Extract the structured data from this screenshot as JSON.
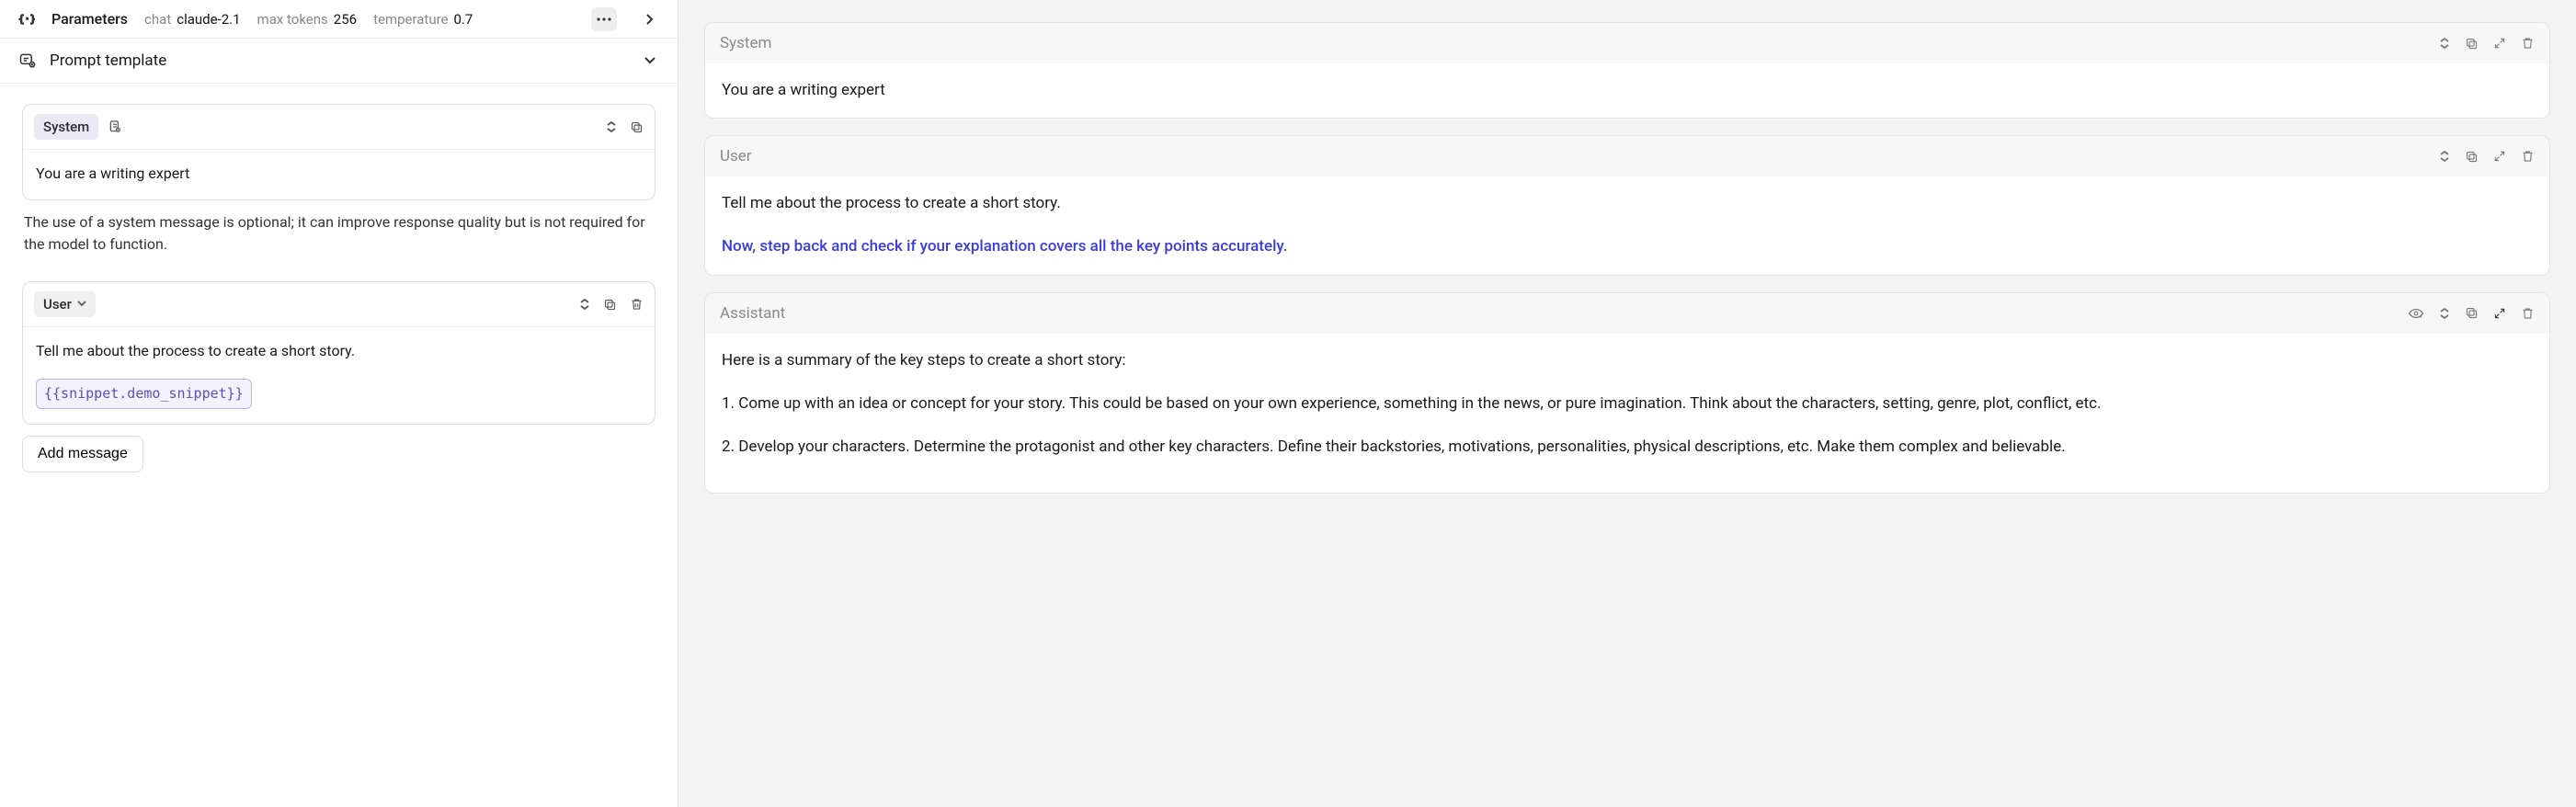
{
  "params": {
    "title": "Parameters",
    "chat_label": "chat",
    "chat_value": "claude-2.1",
    "max_tokens_label": "max tokens",
    "max_tokens_value": "256",
    "temp_label": "temperature",
    "temp_value": "0.7"
  },
  "template_row": {
    "title": "Prompt template"
  },
  "left_system": {
    "role": "System",
    "content": "You are a writing expert",
    "hint": "The use of a system message is optional; it can improve response quality but is not required for the model to function."
  },
  "left_user": {
    "role": "User",
    "content": "Tell me about the process to create a short story.",
    "snippet": "{{snippet.demo_snippet}}"
  },
  "add_message_label": "Add message",
  "right": {
    "system": {
      "role": "System",
      "content": "You are a writing expert"
    },
    "user": {
      "role": "User",
      "line1": "Tell me about the process to create a short story.",
      "line2": "Now, step back and check if your explanation covers all the key points accurately."
    },
    "assistant": {
      "role": "Assistant",
      "p0": "Here is a summary of the key steps to create a short story:",
      "p1": "1. Come up with an idea or concept for your story. This could be based on your own experience, something in the news, or pure imagination. Think about the characters, setting, genre, plot, conflict, etc.",
      "p2": "2. Develop your characters. Determine the protagonist and other key characters. Define their backstories, motivations, personalities, physical descriptions, etc. Make them complex and believable."
    }
  }
}
